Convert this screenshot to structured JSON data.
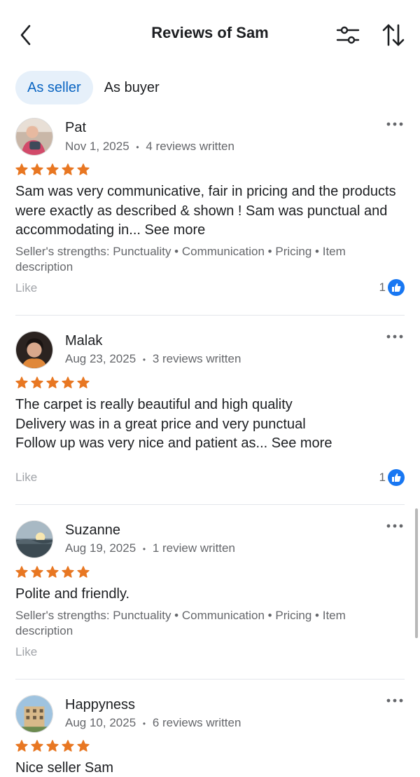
{
  "header": {
    "title": "Reviews of Sam",
    "back_icon": "chevron-left-icon",
    "filter_icon": "sliders-icon",
    "sort_icon": "sort-arrows-icon"
  },
  "tabs": [
    {
      "label": "As seller",
      "active": true
    },
    {
      "label": "As buyer",
      "active": false
    }
  ],
  "colors": {
    "accent": "#0a65c2",
    "active_tab_bg": "#e6f0fa",
    "star": "#e87722",
    "like_badge": "#1877f2",
    "muted_text": "#65676b"
  },
  "reviews": [
    {
      "name": "Pat",
      "date": "Nov 1, 2025",
      "reviews_written": "4 reviews written",
      "rating": 5,
      "text": "Sam was very communicative, fair in pricing and the products were exactly as described & shown ! Sam was punctual and accommodating in...",
      "see_more": "See more",
      "strengths": "Seller's strengths: Punctuality • Communication • Pricing • Item description",
      "like_label": "Like",
      "like_count": "1"
    },
    {
      "name": "Malak",
      "date": "Aug 23, 2025",
      "reviews_written": "3 reviews written",
      "rating": 5,
      "lines": [
        "The carpet is really beautiful and high quality",
        "Delivery was in a great price and very punctual",
        "Follow up was very nice and patient as..."
      ],
      "see_more": "See more",
      "like_label": "Like",
      "like_count": "1"
    },
    {
      "name": "Suzanne",
      "date": "Aug 19, 2025",
      "reviews_written": "1 review written",
      "rating": 5,
      "text": "Polite and friendly.",
      "strengths": "Seller's strengths: Punctuality • Communication • Pricing • Item description",
      "like_label": "Like"
    },
    {
      "name": "Happyness",
      "date": "Aug 10, 2025",
      "reviews_written": "6 reviews written",
      "rating": 5,
      "text": "Nice seller Sam"
    }
  ],
  "meta_separator": "•"
}
